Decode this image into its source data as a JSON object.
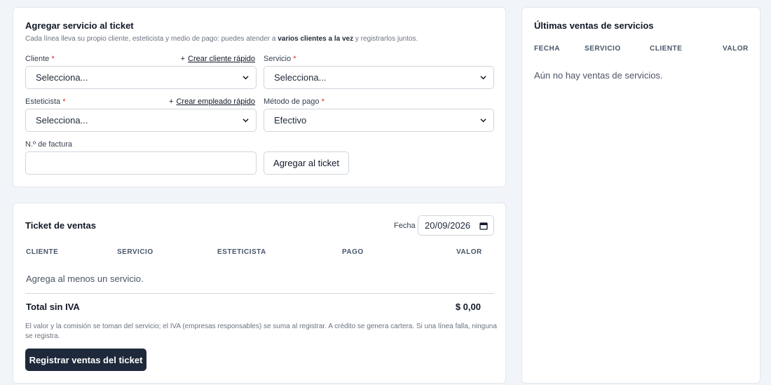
{
  "add_service": {
    "title": "Agregar servicio al ticket",
    "subtitle_pre": "Cada línea lleva su propio cliente, esteticista y medio de pago: puedes atender a ",
    "subtitle_bold": "varios clientes a la vez",
    "subtitle_post": " y registrarlos juntos.",
    "client_label": "Cliente",
    "client_link": "Crear cliente rápido",
    "client_value": "Selecciona...",
    "service_label": "Servicio",
    "service_value": "Selecciona...",
    "stylist_label": "Esteticista",
    "stylist_link": "Crear empleado rápido",
    "stylist_value": "Selecciona...",
    "payment_label": "Método de pago",
    "payment_value": "Efectivo",
    "invoice_label": "N.º de factura",
    "invoice_value": "",
    "required_mark": "*",
    "plus": "+",
    "add_button": "Agregar al ticket"
  },
  "ticket": {
    "title": "Ticket de ventas",
    "date_label": "Fecha",
    "date_value": "20/09/2026",
    "columns": [
      "CLIENTE",
      "SERVICIO",
      "ESTETICISTA",
      "PAGO",
      "VALOR"
    ],
    "empty_text": "Agrega al menos un servicio.",
    "total_label": "Total sin IVA",
    "total_value": "$ 0,00",
    "note": "El valor y la comisión se toman del servicio; el IVA (empresas responsables) se suma al registrar. A crédito se genera cartera. Si una línea falla, ninguna se registra.",
    "register_button": "Registrar ventas del ticket"
  },
  "recent": {
    "title": "Últimas ventas de servicios",
    "columns": [
      "FECHA",
      "SERVICIO",
      "CLIENTE",
      "VALOR"
    ],
    "empty_text": "Aún no hay ventas de servicios."
  }
}
